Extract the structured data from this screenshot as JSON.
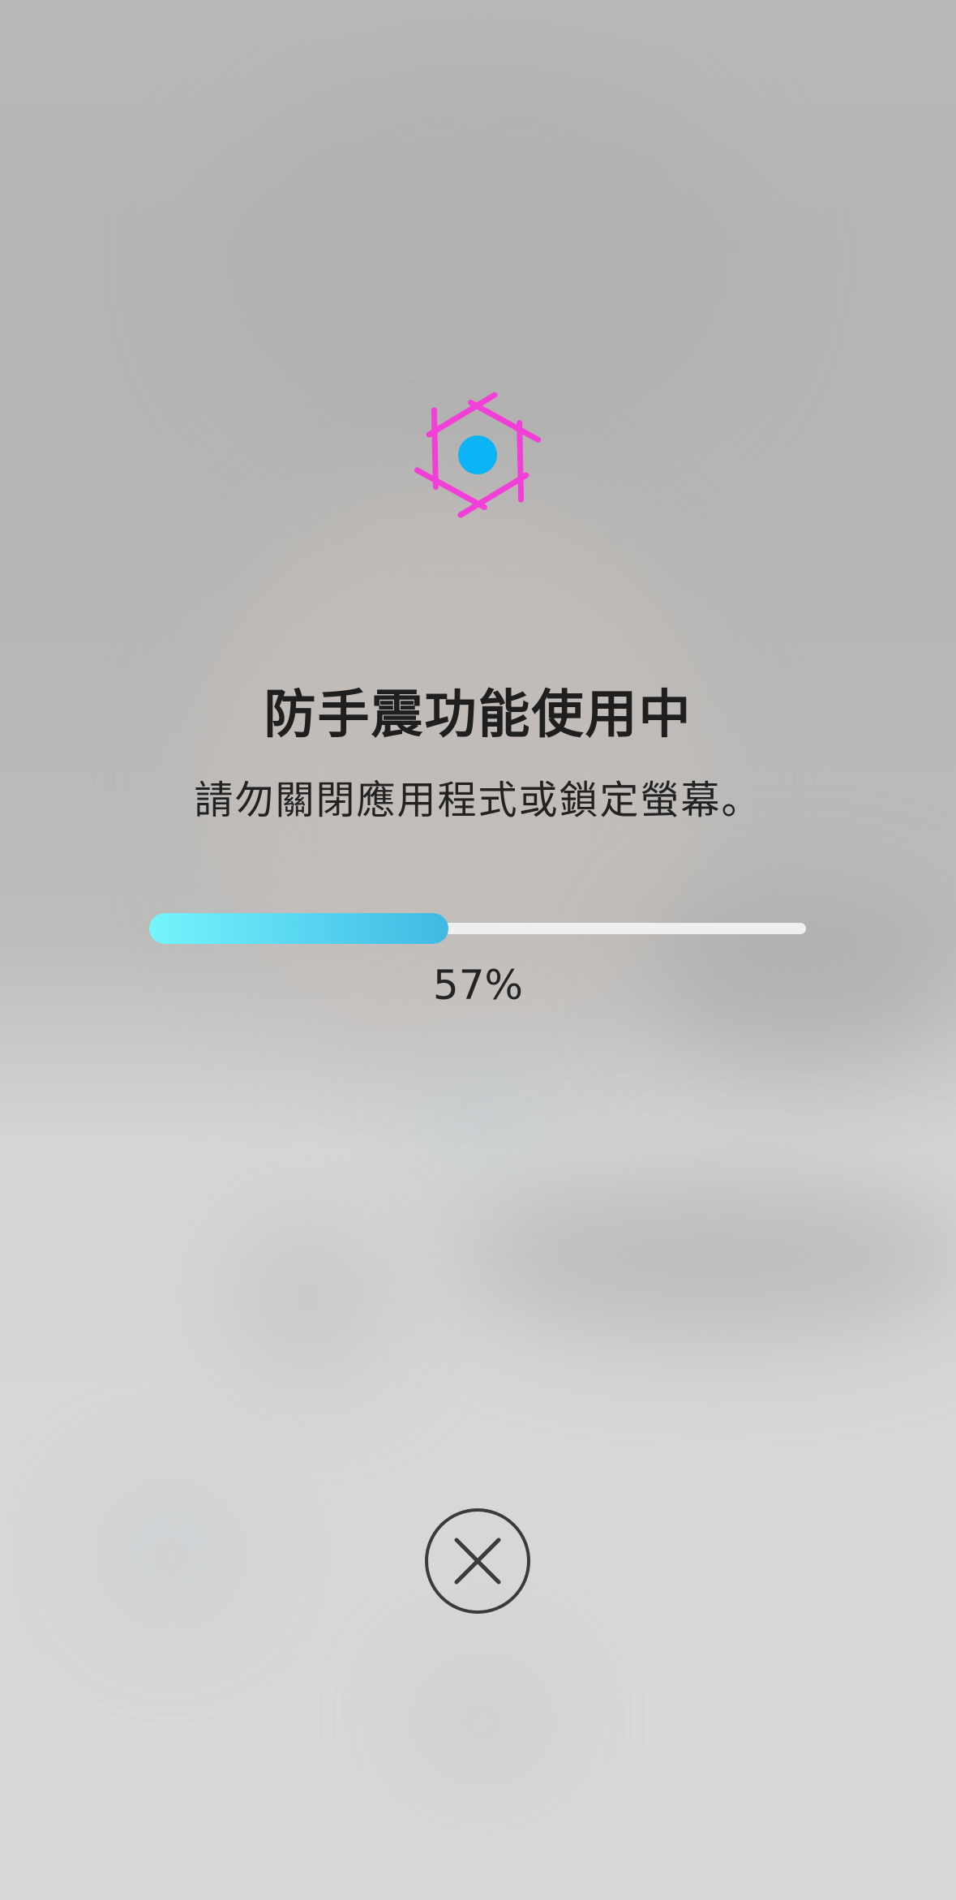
{
  "dialog": {
    "title": "防手震功能使用中",
    "message": "請勿關閉應用程式或鎖定螢幕。"
  },
  "progress": {
    "percent": 57,
    "label": "57%"
  },
  "icons": {
    "stabilizer": "stabilizer-icon",
    "close": "close-icon"
  },
  "colors": {
    "accent_magenta": "#f23fd8",
    "accent_blue": "#0bb4f4",
    "progress_start": "#74f5fb",
    "progress_end": "#3fb9e3",
    "track": "#efefef",
    "text": "#1f1f1f"
  }
}
